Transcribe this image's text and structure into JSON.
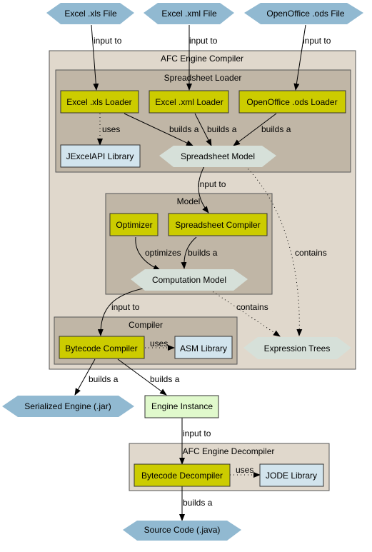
{
  "colors": {
    "file_node": "#91b9d1",
    "component": "#cccc00",
    "library": "#d2e4ed",
    "model_node": "#d6e0d9",
    "instance": "#e0f9cc",
    "outer_cluster": "#e0d8cc",
    "inner_cluster": "#c0b6a6"
  },
  "clusters": {
    "afc_compiler": "AFC Engine Compiler",
    "spreadsheet_loader": "Spreadsheet Loader",
    "model": "Model",
    "compiler": "Compiler",
    "afc_decompiler": "AFC Engine Decompiler"
  },
  "nodes": {
    "excel_xls_file": "Excel .xls File",
    "excel_xml_file": "Excel .xml File",
    "ods_file": "OpenOffice .ods File",
    "excel_xls_loader": "Excel .xls Loader",
    "excel_xml_loader": "Excel .xml Loader",
    "ods_loader": "OpenOffice .ods Loader",
    "jexcelapi": "JExcelAPI Library",
    "spreadsheet_model": "Spreadsheet Model",
    "optimizer": "Optimizer",
    "spreadsheet_compiler": "Spreadsheet Compiler",
    "computation_model": "Computation Model",
    "bytecode_compiler": "Bytecode Compiler",
    "asm_library": "ASM Library",
    "expression_trees": "Expression Trees",
    "serialized_engine": "Serialized Engine (.jar)",
    "engine_instance": "Engine Instance",
    "bytecode_decompiler": "Bytecode Decompiler",
    "jode_library": "JODE Library",
    "source_code": "Source Code (.java)"
  },
  "edges": {
    "xls_input": "input to",
    "xml_input": "input to",
    "ods_input": "input to",
    "xls_uses": "uses",
    "xls_builds": "builds a",
    "xml_builds": "builds a",
    "ods_builds": "builds a",
    "model_input": "input to",
    "ss_contains": "contains",
    "optimizes": "optimizes",
    "sc_builds": "builds a",
    "cm_input": "input to",
    "cm_contains": "contains",
    "bc_uses": "uses",
    "bc_builds_jar": "builds a",
    "bc_builds_inst": "builds a",
    "inst_input": "input to",
    "bd_uses": "uses",
    "bd_builds": "builds a"
  }
}
